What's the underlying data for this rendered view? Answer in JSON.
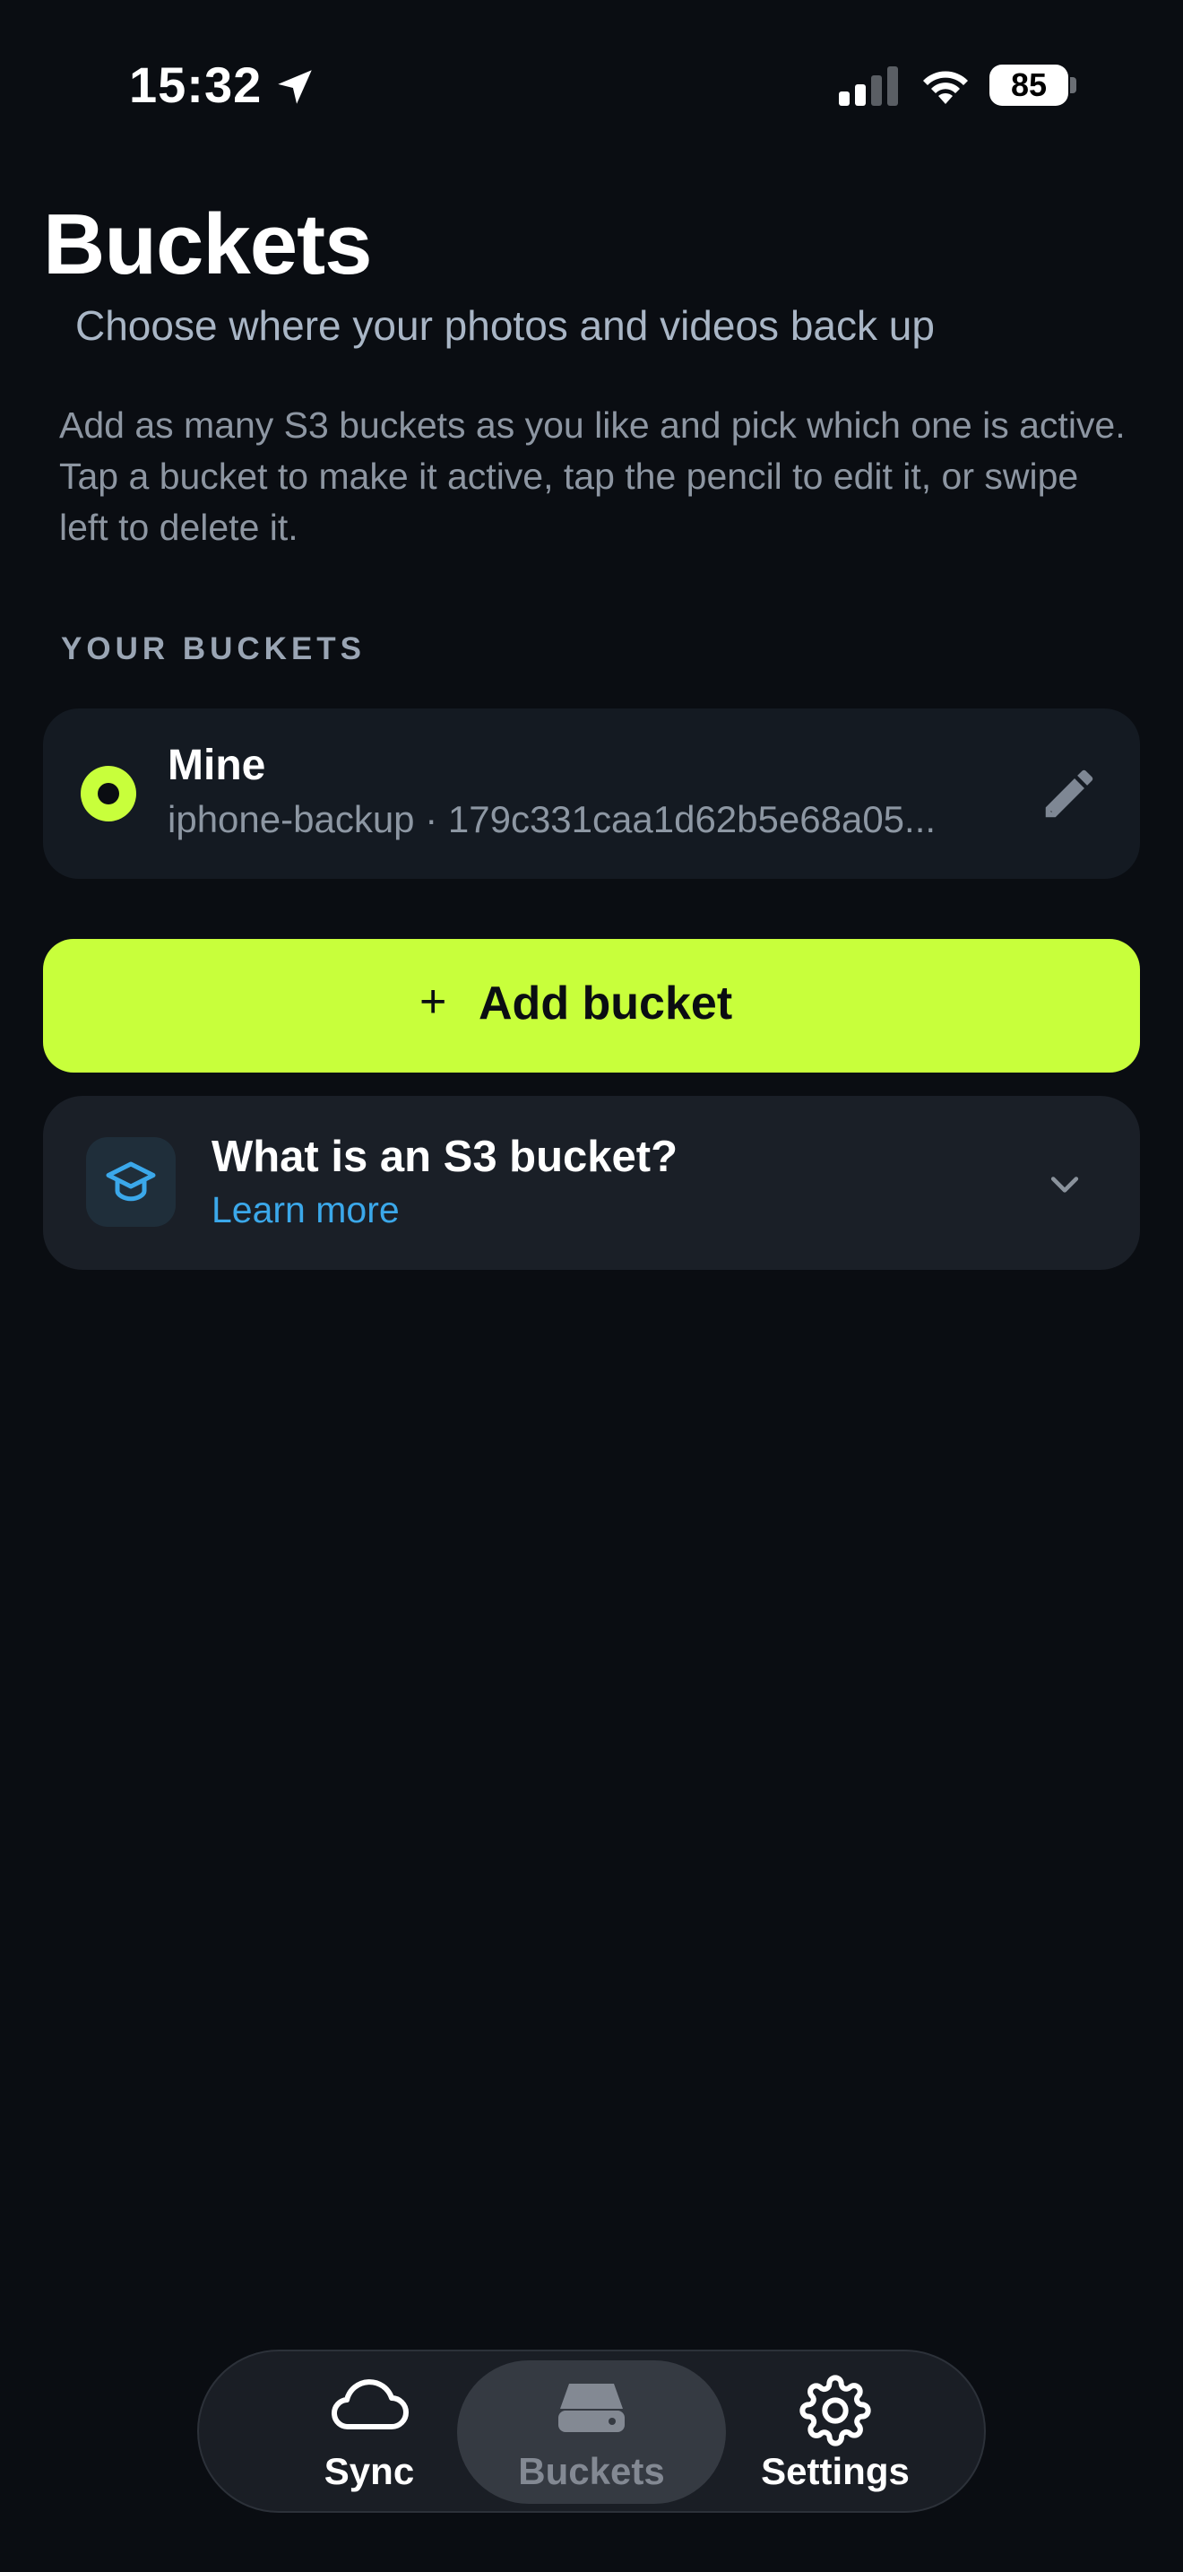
{
  "status_bar": {
    "time": "15:32",
    "battery": "85"
  },
  "header": {
    "title": "Buckets",
    "subtitle": "Choose where your photos and videos back up"
  },
  "description": "Add as many S3 buckets as you like and pick which one is active. Tap a bucket to make it active, tap the pencil to edit it, or swipe left to delete it.",
  "section_header": "YOUR BUCKETS",
  "buckets": [
    {
      "name": "Mine",
      "detail": "iphone-backup · 179c331caa1d62b5e68a05...",
      "active": true
    }
  ],
  "add_button": {
    "icon": "+",
    "label": "Add bucket"
  },
  "info_card": {
    "title": "What is an S3 bucket?",
    "link": "Learn more"
  },
  "tab_bar": {
    "tabs": [
      {
        "label": "Sync",
        "icon": "cloud-icon"
      },
      {
        "label": "Buckets",
        "icon": "drive-icon",
        "selected": true
      },
      {
        "label": "Settings",
        "icon": "gear-icon"
      }
    ]
  },
  "colors": {
    "background": "#0a0d12",
    "accent": "#c8ff3b",
    "link": "#3ba8ea",
    "card": "#141a22"
  }
}
